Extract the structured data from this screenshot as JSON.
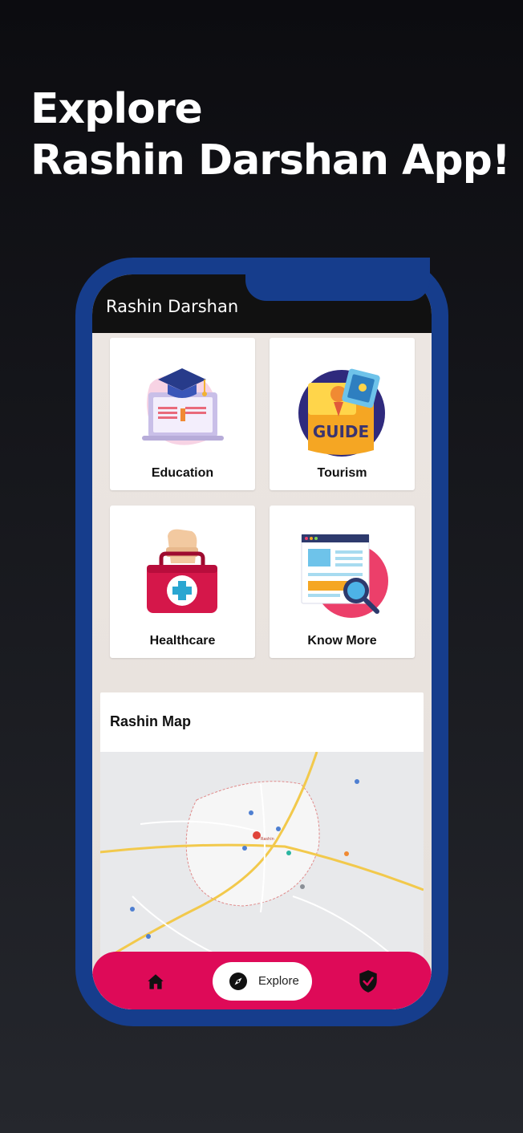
{
  "headline": {
    "line1": "Explore",
    "line2": "Rashin Darshan App!"
  },
  "app": {
    "title": "Rashin Darshan"
  },
  "categories": [
    {
      "label": "Education",
      "icon": "education-icon"
    },
    {
      "label": "Tourism",
      "icon": "tourism-guide-icon"
    },
    {
      "label": "Healthcare",
      "icon": "medical-kit-icon"
    },
    {
      "label": "Know More",
      "icon": "search-document-icon"
    }
  ],
  "map": {
    "title": "Rashin Map",
    "center_label": "Rashin"
  },
  "bottom_nav": {
    "items": [
      {
        "icon": "home-icon",
        "label": ""
      },
      {
        "icon": "compass-icon",
        "label": "Explore",
        "active": true
      },
      {
        "icon": "shield-icon",
        "label": ""
      }
    ]
  },
  "colors": {
    "phone_frame": "#163d8c",
    "nav_bar": "#de0a58",
    "app_bar": "#111111"
  }
}
